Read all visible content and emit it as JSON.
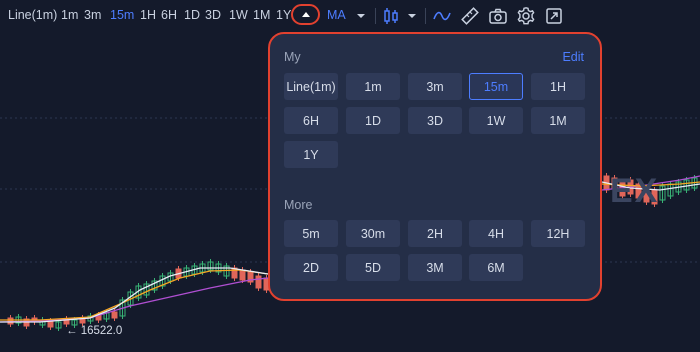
{
  "toolbar": {
    "intervals": [
      "Line(1m)",
      "1m",
      "3m",
      "15m",
      "1H",
      "6H",
      "1D",
      "3D",
      "1W",
      "1M",
      "1Y"
    ],
    "active_interval": "15m",
    "indicator": "MA",
    "icons": [
      "expand-intervals-icon",
      "indicator-dropdown-icon",
      "candlestick-type-icon",
      "chart-type-dropdown-icon",
      "line-draw-icon",
      "ruler-icon",
      "camera-icon",
      "settings-icon",
      "fullscreen-icon"
    ]
  },
  "panel": {
    "my_label": "My",
    "edit_label": "Edit",
    "my_intervals": [
      "Line(1m)",
      "1m",
      "3m",
      "15m",
      "1H",
      "6H",
      "1D",
      "3D",
      "1W",
      "1M",
      "1Y"
    ],
    "selected": "15m",
    "more_label": "More",
    "more_intervals": [
      "5m",
      "30m",
      "2H",
      "4H",
      "12H",
      "2D",
      "5D",
      "3M",
      "6M"
    ]
  },
  "chart": {
    "price_label": "← 16522.0",
    "watermark": "EX",
    "colors": {
      "up": "#38b275",
      "down": "#e0665a",
      "ma_white": "#e8ecf5",
      "ma_orange": "#f5a623",
      "ma_purple": "#b04fd2"
    }
  }
}
